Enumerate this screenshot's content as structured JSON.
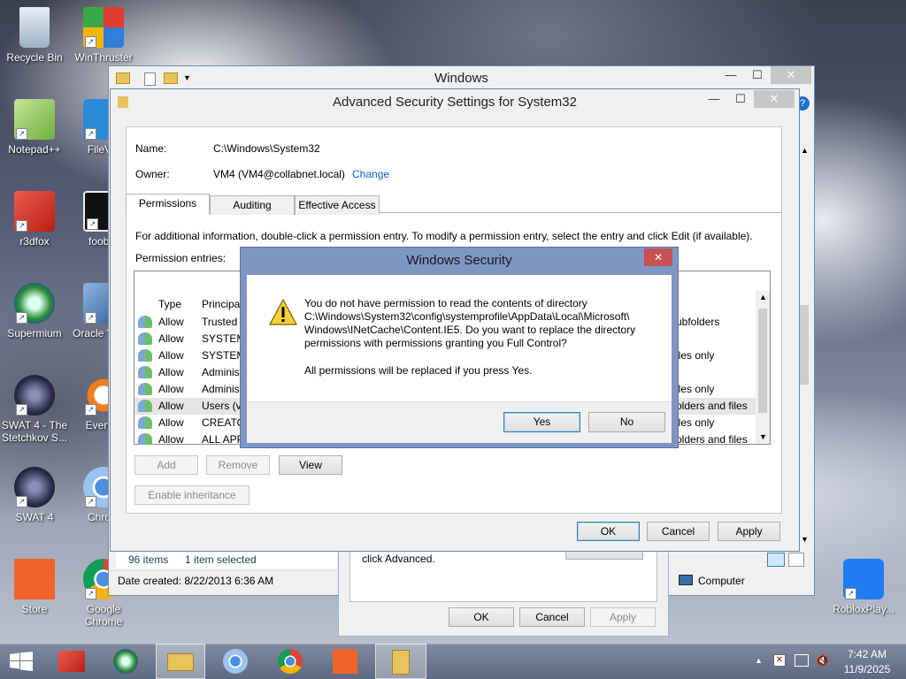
{
  "desktop_icons": [
    {
      "label": "Recycle Bin",
      "icon": "recycle-bin-icon"
    },
    {
      "label": "WinThruster",
      "icon": "winthruster-icon"
    },
    {
      "label": "Notepad++",
      "icon": "notepadpp-icon"
    },
    {
      "label": "FileVie",
      "icon": "fileviewer-icon"
    },
    {
      "label": "r3dfox",
      "icon": "r3dfox-icon"
    },
    {
      "label": "foobar",
      "icon": "foobar-icon"
    },
    {
      "label": "Supermium",
      "icon": "supermium-icon"
    },
    {
      "label": "Oracle Virtua",
      "icon": "virtualbox-icon"
    },
    {
      "label": "SWAT 4 - The Stetchkov S...",
      "icon": "swat4-icon"
    },
    {
      "label": "Everyth",
      "icon": "everything-icon"
    },
    {
      "label": "SWAT 4",
      "icon": "swat4-icon"
    },
    {
      "label": "Chrom",
      "icon": "chromium-icon"
    },
    {
      "label": "Store",
      "icon": "store-icon"
    },
    {
      "label": "Google Chrome",
      "icon": "chrome-icon"
    },
    {
      "label": "RobloxPlay...",
      "icon": "roblox-icon"
    }
  ],
  "explorer": {
    "title": "Windows",
    "status_items": "96 items",
    "status_selected": "1 item selected",
    "date_created": "Date created: 8/22/2013 6:36 AM",
    "computer": "Computer"
  },
  "properties": {
    "hint": "click Advanced.",
    "ok": "OK",
    "cancel": "Cancel",
    "apply": "Apply"
  },
  "advanced": {
    "title": "Advanced Security Settings for System32",
    "name_label": "Name:",
    "name_value": "C:\\Windows\\System32",
    "owner_label": "Owner:",
    "owner_value": "VM4 (VM4@collabnet.local)",
    "change_link": "Change",
    "tabs": [
      "Permissions",
      "Auditing",
      "Effective Access"
    ],
    "info": "For additional information, double-click a permission entry. To modify a permission entry, select the entry and click Edit (if available).",
    "entries_label": "Permission entries:",
    "columns": {
      "type": "Type",
      "principal": "Principa"
    },
    "rows": [
      {
        "type": "Allow",
        "principal": "Trusted",
        "applies": "ubfolders"
      },
      {
        "type": "Allow",
        "principal": "SYSTEM",
        "applies": ""
      },
      {
        "type": "Allow",
        "principal": "SYSTEM",
        "applies": "iles only"
      },
      {
        "type": "Allow",
        "principal": "Adminis",
        "applies": ""
      },
      {
        "type": "Allow",
        "principal": "Adminis",
        "applies": "iles only"
      },
      {
        "type": "Allow",
        "principal": "Users (v",
        "applies": "olders and files"
      },
      {
        "type": "Allow",
        "principal": "CREATO",
        "applies": "iles only"
      },
      {
        "type": "Allow",
        "principal": "ALL APP",
        "applies": "olders and files"
      }
    ],
    "add": "Add",
    "remove": "Remove",
    "view": "View",
    "enable_inheritance": "Enable inheritance",
    "ok": "OK",
    "cancel": "Cancel",
    "apply": "Apply"
  },
  "dialog": {
    "title": "Windows Security",
    "message": "You do not have permission to read the contents of directory C:\\Windows\\System32\\config\\systemprofile\\AppData\\Local\\Microsoft\\ Windows\\INetCache\\Content.IE5. Do you want to replace the directory permissions with permissions granting you Full Control?",
    "note": "All permissions will be replaced if you press Yes.",
    "yes": "Yes",
    "no": "No"
  },
  "taskbar": {
    "time": "7:42 AM",
    "date": "11/9/2025",
    "items": [
      "start-icon",
      "r3dfox-icon",
      "supermium-icon",
      "file-explorer-icon",
      "chromium-icon",
      "chrome-icon",
      "store-icon",
      "folder-icon"
    ]
  }
}
